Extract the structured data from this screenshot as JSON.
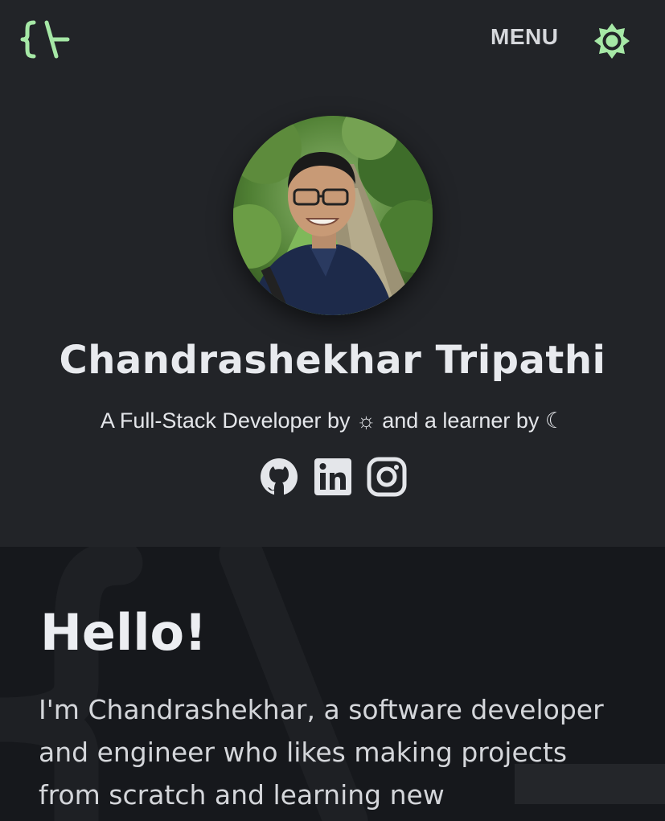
{
  "header": {
    "logo_icon": "code-brace-logo-icon",
    "menu_label": "MENU",
    "theme_icon": "sun-icon",
    "accent_color": "#a6e8a6"
  },
  "profile": {
    "name": "Chandrashekhar Tripathi",
    "tagline": "A Full-Stack Developer by ☼ and a learner by ☾",
    "socials": [
      {
        "icon": "github-icon"
      },
      {
        "icon": "linkedin-icon"
      },
      {
        "icon": "instagram-icon"
      }
    ]
  },
  "about": {
    "heading": "Hello!",
    "bio": "I'm Chandrashekhar, a software developer and engineer who likes making projects from scratch and learning new"
  }
}
